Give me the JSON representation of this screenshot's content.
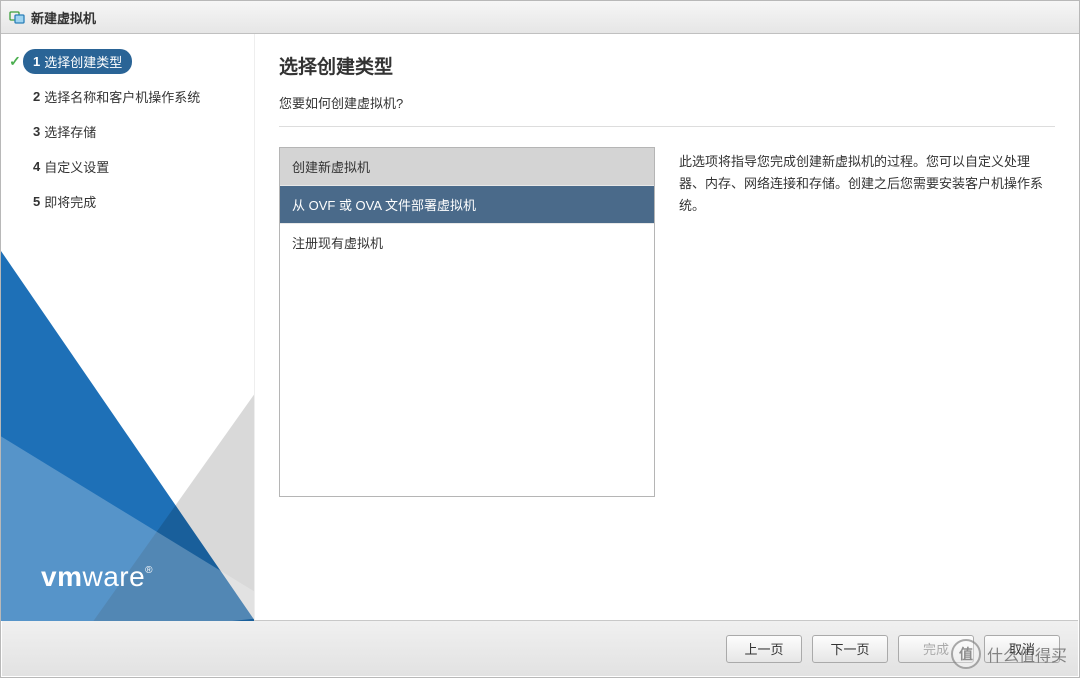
{
  "titlebar": {
    "title": "新建虚拟机"
  },
  "sidebar": {
    "steps": [
      {
        "num": "1",
        "label": "选择创建类型",
        "active": true,
        "checked": true
      },
      {
        "num": "2",
        "label": "选择名称和客户机操作系统",
        "active": false,
        "checked": false
      },
      {
        "num": "3",
        "label": "选择存储",
        "active": false,
        "checked": false
      },
      {
        "num": "4",
        "label": "自定义设置",
        "active": false,
        "checked": false
      },
      {
        "num": "5",
        "label": "即将完成",
        "active": false,
        "checked": false
      }
    ],
    "brand_bold": "vm",
    "brand_light": "ware",
    "brand_reg": "®"
  },
  "main": {
    "title": "选择创建类型",
    "subtitle": "您要如何创建虚拟机?",
    "options": [
      {
        "label": "创建新虚拟机",
        "state": "header"
      },
      {
        "label": "从 OVF 或 OVA 文件部署虚拟机",
        "state": "selected"
      },
      {
        "label": "注册现有虚拟机",
        "state": "normal"
      }
    ],
    "description": "此选项将指导您完成创建新虚拟机的过程。您可以自定义处理器、内存、网络连接和存储。创建之后您需要安装客户机操作系统。"
  },
  "footer": {
    "back": "上一页",
    "next": "下一页",
    "finish": "完成",
    "cancel": "取消"
  },
  "watermark": {
    "circle_text": "值",
    "text": "什么值得买"
  }
}
